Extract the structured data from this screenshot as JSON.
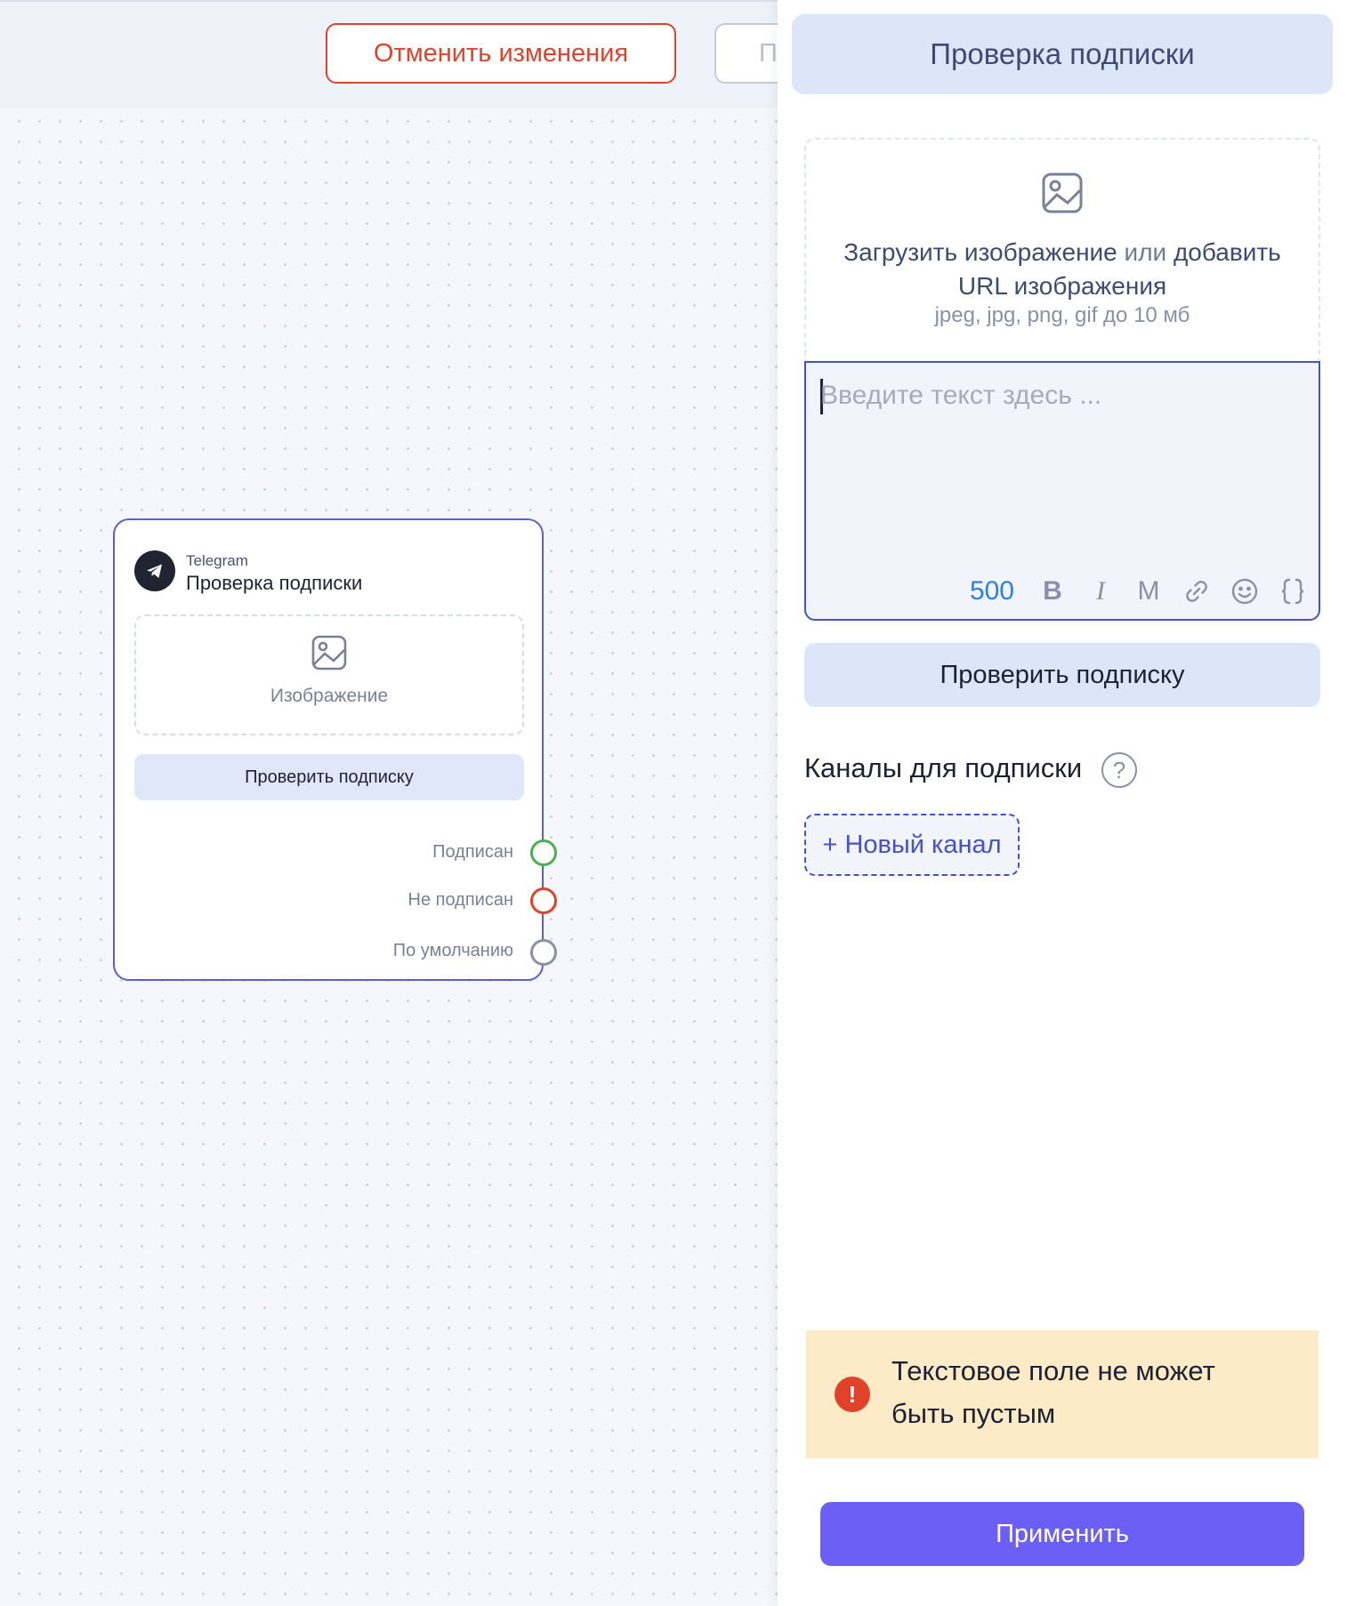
{
  "topbar": {
    "cancel_label": "Отменить изменения",
    "next_label_partial": "П"
  },
  "node": {
    "platform": "Telegram",
    "title": "Проверка подписки",
    "image_label": "Изображение",
    "check_button": "Проверить подписку",
    "outputs": [
      {
        "label": "Подписан",
        "color": "#4caf50"
      },
      {
        "label": "Не подписан",
        "color": "#e0432a"
      },
      {
        "label": "По умолчанию",
        "color": "#8a91a6"
      }
    ]
  },
  "panel": {
    "title": "Проверка подписки",
    "upload": {
      "upload_link": "Загрузить изображение",
      "or": "или",
      "add_link_1": "добавить",
      "add_link_2": "URL изображения",
      "hint": "jpeg, jpg, png, gif до 10 мб"
    },
    "editor": {
      "placeholder": "Введите текст здесь ...",
      "counter": "500",
      "tools": [
        "B",
        "I",
        "M",
        "link-icon",
        "emoji-icon",
        "variables-icon"
      ]
    },
    "check_button": "Проверить подписку",
    "channels_title": "Каналы для подписки",
    "help": "?",
    "new_channel": "+ Новый канал",
    "warning": {
      "icon": "!",
      "text": "Текстовое поле не может быть пустым"
    },
    "apply": "Применить"
  },
  "colors": {
    "accent": "#6c5ff5",
    "border_active": "#4650c8",
    "danger": "#e0432a",
    "warning_bg": "#fdebc8",
    "counter": "#2f7fde"
  }
}
